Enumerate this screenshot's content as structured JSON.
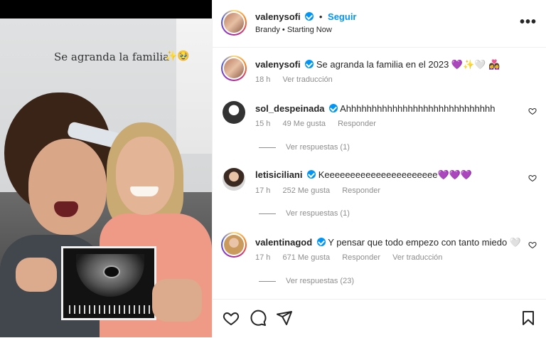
{
  "photo": {
    "caption": "Se agranda la familia",
    "caption_emoji": "✨🥹"
  },
  "header": {
    "username": "valenysofi",
    "separator": "•",
    "follow_label": "Seguir",
    "subtitle": "Brandy • Starting Now",
    "more_icon": "more-options-icon"
  },
  "post": {
    "username": "valenysofi",
    "caption": "Se agranda la familia en el 2023 💜✨🤍 👩‍❤️‍👩",
    "time": "18 h",
    "translate": "Ver traducción"
  },
  "comments": [
    {
      "username": "sol_despeinada",
      "text": "Ahhhhhhhhhhhhhhhhhhhhhhhhhhhhh",
      "time": "15 h",
      "likes": "49 Me gusta",
      "reply": "Responder",
      "view_replies": "Ver respuestas (1)"
    },
    {
      "username": "letisiciliani",
      "text": "Keeeeeeeeeeeeeeeeeeeeee💜💜💜",
      "time": "17 h",
      "likes": "252 Me gusta",
      "reply": "Responder",
      "view_replies": "Ver respuestas (1)"
    },
    {
      "username": "valentinagod",
      "text": "Y pensar que todo empezo con tanto miedo 🤍",
      "time": "17 h",
      "likes": "671 Me gusta",
      "reply": "Responder",
      "translate": "Ver traducción",
      "view_replies": "Ver respuestas (23)"
    }
  ],
  "icons": {
    "verified": "verified-badge-icon",
    "like": "heart-icon",
    "comment": "comment-icon",
    "share": "share-icon",
    "save": "bookmark-icon"
  },
  "colors": {
    "accent": "#0095f6",
    "text": "#262626",
    "muted": "#8e8e8e"
  }
}
